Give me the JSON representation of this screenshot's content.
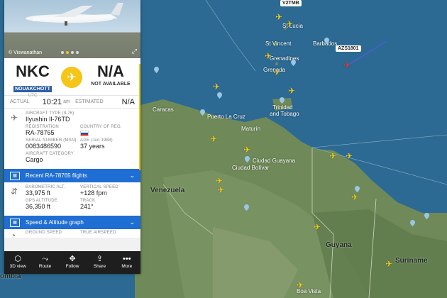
{
  "map": {
    "labels": {
      "v2tmb": "V2TMB",
      "saint_lucia": "St Lucia",
      "st_vincent": "St Vincent",
      "grenadines": "Grenadines",
      "barbados": "Barbados",
      "grenada": "Grenada",
      "trinidad": "Trinidad",
      "and_tobago": "and Tobago",
      "caracas": "Caracas",
      "puerto_la_cruz": "Puerto La Cruz",
      "maturin": "Maturín",
      "ciudad_guayana": "Ciudad Guayana",
      "ciudad_bolivar": "Ciudad Bolívar",
      "venezuela": "Venezuela",
      "guyana": "Guyana",
      "suriname": "Suriname",
      "boa_vista": "Boa Vista",
      "colombia": "ombia",
      "azs1801": "AZS1801"
    }
  },
  "photo": {
    "credit": "© Viswanathan",
    "expand_icon": "expand-icon"
  },
  "route": {
    "origin_code": "NKC",
    "origin_name": "NOUAKCHOTT",
    "origin_tz": "UTC",
    "dest_code": "N/A",
    "dest_name": "NOT AVAILABLE"
  },
  "times": {
    "actual_label": "ACTUAL",
    "actual_value": "10:21",
    "actual_suffix": "am",
    "estimated_label": "ESTIMATED",
    "estimated_value": "N/A"
  },
  "aircraft": {
    "type_label": "AIRCRAFT TYPE (IL76)",
    "type_value": "Ilyushin Il-76TD",
    "registration_label": "REGISTRATION",
    "registration_value": "RA-78765",
    "country_label": "COUNTRY OF REG.",
    "serial_label": "SERIAL NUMBER (MSN)",
    "serial_value": "0083486590",
    "age_label": "AGE (Jun 1988)",
    "age_value": "37 years",
    "category_label": "AIRCRAFT CATEGORY",
    "category_value": "Cargo"
  },
  "bars": {
    "recent_flights": "Recent RA-78765 flights",
    "speed_altitude": "Speed & Altitude graph"
  },
  "altitude": {
    "baro_label": "BAROMETRIC ALT.",
    "baro_value": "33,975 ft",
    "vspeed_label": "VERTICAL SPEED",
    "vspeed_value": "+128 fpm",
    "gps_label": "GPS ALTITUDE",
    "gps_value": "36,350 ft",
    "track_label": "TRACK",
    "track_value": "241°"
  },
  "speed": {
    "ground_label": "GROUND SPEED",
    "true_label": "TRUE AIRSPEED"
  },
  "toolbar": {
    "view3d": "3D view",
    "route": "Route",
    "follow": "Follow",
    "share": "Share",
    "more": "More"
  },
  "colors": {
    "accent_yellow": "#f5c518",
    "bar_blue": "#1f6ed4",
    "sea": "#2c6a93",
    "land": "#7a8f64"
  }
}
